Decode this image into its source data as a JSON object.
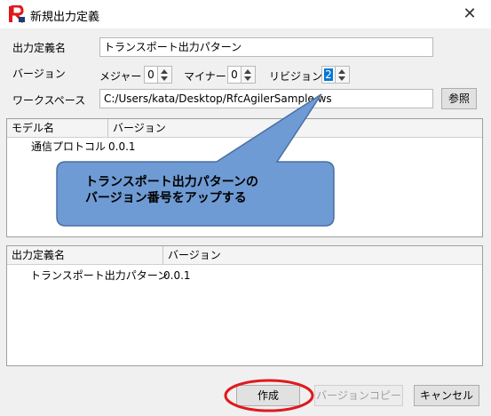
{
  "window": {
    "title": "新規出力定義",
    "close_glyph": "✕"
  },
  "form": {
    "definition_name_label": "出力定義名",
    "definition_name_value": "トランスポート出力パターン",
    "version_label": "バージョン",
    "major_label": "メジャー",
    "major_value": "0",
    "minor_label": "マイナー",
    "minor_value": "0",
    "revision_label": "リビジョン",
    "revision_value": "2",
    "workspace_label": "ワークスペース",
    "workspace_value": "C:/Users/kata/Desktop/RfcAgilerSample.ws",
    "browse_button": "参照"
  },
  "model_table": {
    "columns": [
      "モデル名",
      "バージョン"
    ],
    "rows": [
      {
        "name": "通信プロトコル",
        "version": "0.0.1"
      }
    ]
  },
  "output_table": {
    "columns": [
      "出力定義名",
      "バージョン"
    ],
    "rows": [
      {
        "name": "トランスポート出力パターン",
        "version": "0.0.1"
      }
    ]
  },
  "buttons": {
    "create": "作成",
    "version_copy": "バージョンコピー",
    "cancel": "キャンセル"
  },
  "annotation": {
    "line1": "トランスポート出力パターンの",
    "line2": "バージョン番号をアップする"
  },
  "colors": {
    "callout_fill": "#6f9bd4",
    "callout_stroke": "#4a6fa5",
    "highlight_ellipse": "#e0191d",
    "app_icon_red": "#e0191d",
    "selection_blue": "#0078d7"
  }
}
